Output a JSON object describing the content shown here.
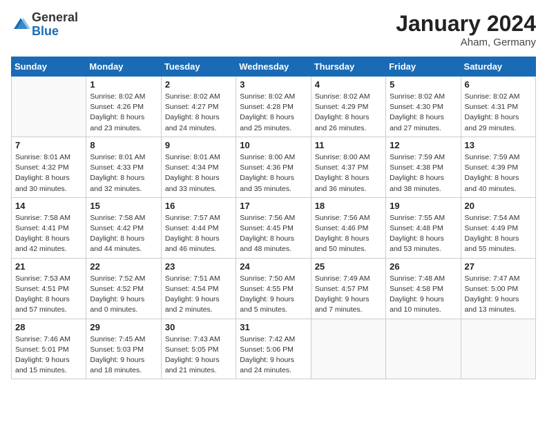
{
  "header": {
    "logo_general": "General",
    "logo_blue": "Blue",
    "month_title": "January 2024",
    "location": "Aham, Germany"
  },
  "columns": [
    "Sunday",
    "Monday",
    "Tuesday",
    "Wednesday",
    "Thursday",
    "Friday",
    "Saturday"
  ],
  "weeks": [
    [
      {
        "day": "",
        "info": ""
      },
      {
        "day": "1",
        "info": "Sunrise: 8:02 AM\nSunset: 4:26 PM\nDaylight: 8 hours\nand 23 minutes."
      },
      {
        "day": "2",
        "info": "Sunrise: 8:02 AM\nSunset: 4:27 PM\nDaylight: 8 hours\nand 24 minutes."
      },
      {
        "day": "3",
        "info": "Sunrise: 8:02 AM\nSunset: 4:28 PM\nDaylight: 8 hours\nand 25 minutes."
      },
      {
        "day": "4",
        "info": "Sunrise: 8:02 AM\nSunset: 4:29 PM\nDaylight: 8 hours\nand 26 minutes."
      },
      {
        "day": "5",
        "info": "Sunrise: 8:02 AM\nSunset: 4:30 PM\nDaylight: 8 hours\nand 27 minutes."
      },
      {
        "day": "6",
        "info": "Sunrise: 8:02 AM\nSunset: 4:31 PM\nDaylight: 8 hours\nand 29 minutes."
      }
    ],
    [
      {
        "day": "7",
        "info": "Sunrise: 8:01 AM\nSunset: 4:32 PM\nDaylight: 8 hours\nand 30 minutes."
      },
      {
        "day": "8",
        "info": "Sunrise: 8:01 AM\nSunset: 4:33 PM\nDaylight: 8 hours\nand 32 minutes."
      },
      {
        "day": "9",
        "info": "Sunrise: 8:01 AM\nSunset: 4:34 PM\nDaylight: 8 hours\nand 33 minutes."
      },
      {
        "day": "10",
        "info": "Sunrise: 8:00 AM\nSunset: 4:36 PM\nDaylight: 8 hours\nand 35 minutes."
      },
      {
        "day": "11",
        "info": "Sunrise: 8:00 AM\nSunset: 4:37 PM\nDaylight: 8 hours\nand 36 minutes."
      },
      {
        "day": "12",
        "info": "Sunrise: 7:59 AM\nSunset: 4:38 PM\nDaylight: 8 hours\nand 38 minutes."
      },
      {
        "day": "13",
        "info": "Sunrise: 7:59 AM\nSunset: 4:39 PM\nDaylight: 8 hours\nand 40 minutes."
      }
    ],
    [
      {
        "day": "14",
        "info": "Sunrise: 7:58 AM\nSunset: 4:41 PM\nDaylight: 8 hours\nand 42 minutes."
      },
      {
        "day": "15",
        "info": "Sunrise: 7:58 AM\nSunset: 4:42 PM\nDaylight: 8 hours\nand 44 minutes."
      },
      {
        "day": "16",
        "info": "Sunrise: 7:57 AM\nSunset: 4:44 PM\nDaylight: 8 hours\nand 46 minutes."
      },
      {
        "day": "17",
        "info": "Sunrise: 7:56 AM\nSunset: 4:45 PM\nDaylight: 8 hours\nand 48 minutes."
      },
      {
        "day": "18",
        "info": "Sunrise: 7:56 AM\nSunset: 4:46 PM\nDaylight: 8 hours\nand 50 minutes."
      },
      {
        "day": "19",
        "info": "Sunrise: 7:55 AM\nSunset: 4:48 PM\nDaylight: 8 hours\nand 53 minutes."
      },
      {
        "day": "20",
        "info": "Sunrise: 7:54 AM\nSunset: 4:49 PM\nDaylight: 8 hours\nand 55 minutes."
      }
    ],
    [
      {
        "day": "21",
        "info": "Sunrise: 7:53 AM\nSunset: 4:51 PM\nDaylight: 8 hours\nand 57 minutes."
      },
      {
        "day": "22",
        "info": "Sunrise: 7:52 AM\nSunset: 4:52 PM\nDaylight: 9 hours\nand 0 minutes."
      },
      {
        "day": "23",
        "info": "Sunrise: 7:51 AM\nSunset: 4:54 PM\nDaylight: 9 hours\nand 2 minutes."
      },
      {
        "day": "24",
        "info": "Sunrise: 7:50 AM\nSunset: 4:55 PM\nDaylight: 9 hours\nand 5 minutes."
      },
      {
        "day": "25",
        "info": "Sunrise: 7:49 AM\nSunset: 4:57 PM\nDaylight: 9 hours\nand 7 minutes."
      },
      {
        "day": "26",
        "info": "Sunrise: 7:48 AM\nSunset: 4:58 PM\nDaylight: 9 hours\nand 10 minutes."
      },
      {
        "day": "27",
        "info": "Sunrise: 7:47 AM\nSunset: 5:00 PM\nDaylight: 9 hours\nand 13 minutes."
      }
    ],
    [
      {
        "day": "28",
        "info": "Sunrise: 7:46 AM\nSunset: 5:01 PM\nDaylight: 9 hours\nand 15 minutes."
      },
      {
        "day": "29",
        "info": "Sunrise: 7:45 AM\nSunset: 5:03 PM\nDaylight: 9 hours\nand 18 minutes."
      },
      {
        "day": "30",
        "info": "Sunrise: 7:43 AM\nSunset: 5:05 PM\nDaylight: 9 hours\nand 21 minutes."
      },
      {
        "day": "31",
        "info": "Sunrise: 7:42 AM\nSunset: 5:06 PM\nDaylight: 9 hours\nand 24 minutes."
      },
      {
        "day": "",
        "info": ""
      },
      {
        "day": "",
        "info": ""
      },
      {
        "day": "",
        "info": ""
      }
    ]
  ]
}
